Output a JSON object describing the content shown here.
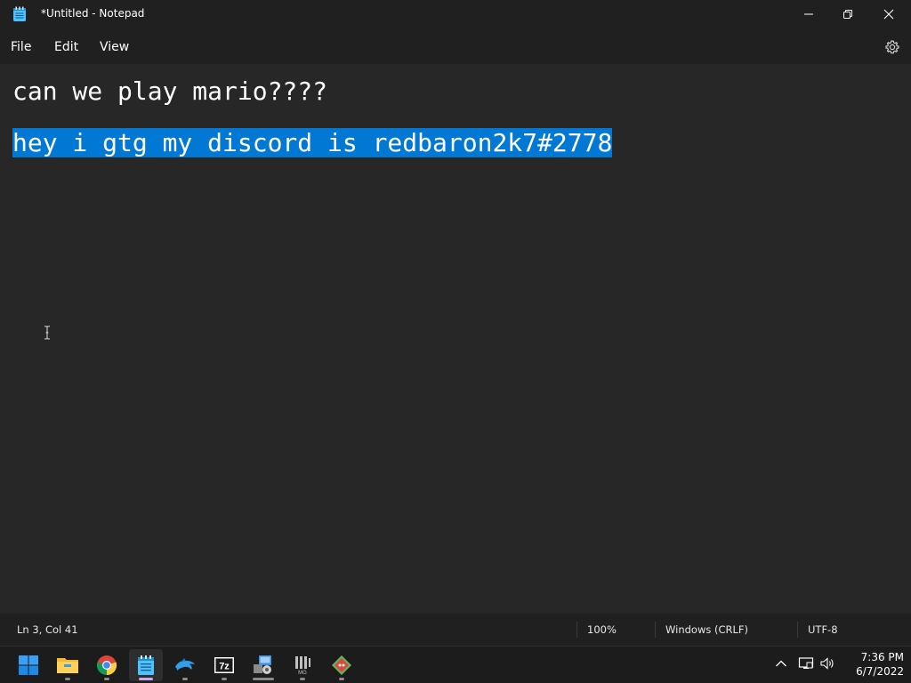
{
  "window": {
    "title": "*Untitled - Notepad"
  },
  "menu": {
    "file": "File",
    "edit": "Edit",
    "view": "View"
  },
  "editor": {
    "lines": [
      "can we play mario????",
      "",
      "hey i gtg my discord is redbaron2k7#2778"
    ],
    "selected_line_index": 2,
    "selection_color": "#0078d4"
  },
  "status": {
    "position": "Ln 3, Col 41",
    "zoom": "100%",
    "line_ending": "Windows (CRLF)",
    "encoding": "UTF-8"
  },
  "taskbar": {
    "apps": [
      {
        "icon": "windows-start-icon"
      },
      {
        "icon": "file-explorer-icon"
      },
      {
        "icon": "chrome-icon"
      },
      {
        "icon": "notepad-icon",
        "active": true
      },
      {
        "icon": "dolphin-emulator-icon"
      },
      {
        "icon": "7zip-icon"
      },
      {
        "icon": "control-panel-icon"
      },
      {
        "icon": "mame-icon"
      },
      {
        "icon": "emulator-game-icon"
      }
    ],
    "tray": {
      "time": "7:36 PM",
      "date": "6/7/2022"
    }
  },
  "colors": {
    "titlebar": "#202020",
    "editor_bg": "#272727",
    "accent": "#0078d4"
  }
}
